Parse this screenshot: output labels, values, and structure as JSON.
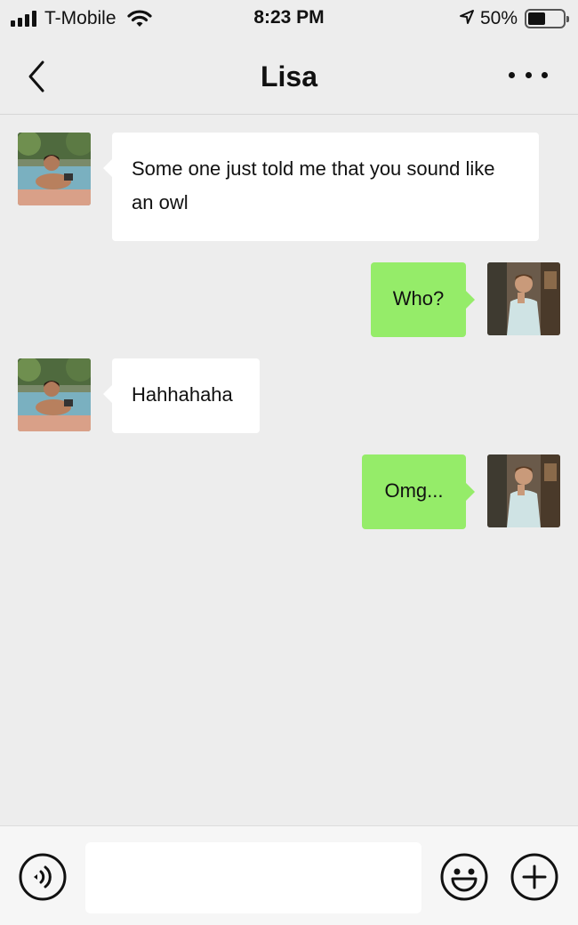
{
  "status_bar": {
    "carrier": "T-Mobile",
    "time": "8:23 PM",
    "battery_percent": "50%",
    "battery_level": 0.5,
    "icons": [
      "signal-icon",
      "wifi-icon",
      "location-arrow-icon",
      "battery-icon"
    ]
  },
  "nav": {
    "title": "Lisa",
    "back_icon": "chevron-left-icon",
    "more_icon": "more-dots-icon"
  },
  "messages": [
    {
      "sender": "Lisa",
      "direction": "incoming",
      "text": "Some one just told me that you sound like an owl"
    },
    {
      "sender": "me",
      "direction": "outgoing",
      "text": "Who?"
    },
    {
      "sender": "Lisa",
      "direction": "incoming",
      "text": "Hahhahaha"
    },
    {
      "sender": "me",
      "direction": "outgoing",
      "text": "Omg..."
    }
  ],
  "input_bar": {
    "message_value": "",
    "voice_icon": "voice-icon",
    "emoji_icon": "emoji-icon",
    "plus_icon": "plus-icon"
  },
  "colors": {
    "background": "#ededed",
    "incoming_bubble": "#ffffff",
    "outgoing_bubble": "#95ec69",
    "input_bar": "#f6f6f6"
  }
}
